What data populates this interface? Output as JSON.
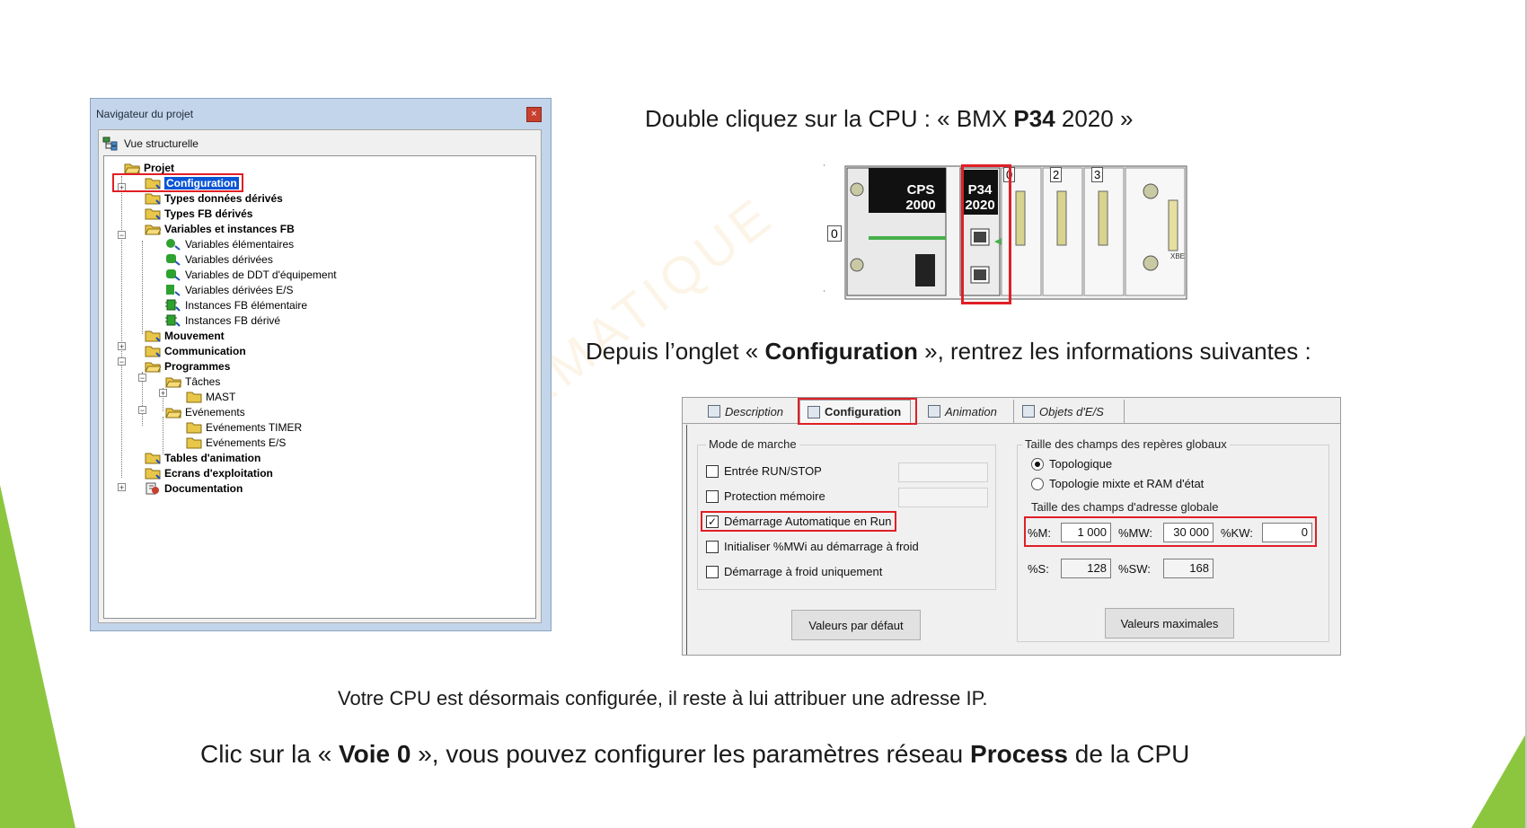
{
  "nav": {
    "title": "Navigateur du projet",
    "close_glyph": "×",
    "view_label": "Vue structurelle",
    "items": [
      {
        "label": "Projet",
        "icon": "folder-open-icon"
      },
      {
        "label": "Configuration",
        "icon": "folder-icon",
        "selected": true
      },
      {
        "label": "Types données dérivés",
        "icon": "folder-icon"
      },
      {
        "label": "Types FB dérivés",
        "icon": "folder-icon"
      },
      {
        "label": "Variables et instances FB",
        "icon": "folder-open-icon"
      },
      {
        "label": "Variables élémentaires",
        "icon": "variable-icon"
      },
      {
        "label": "Variables dérivées",
        "icon": "variable-icon"
      },
      {
        "label": "Variables de DDT d'équipement",
        "icon": "variable-icon"
      },
      {
        "label": "Variables dérivées E/S",
        "icon": "variable-icon"
      },
      {
        "label": "Instances FB élémentaire",
        "icon": "fb-instance-icon"
      },
      {
        "label": "Instances FB dérivé",
        "icon": "fb-instance-icon"
      },
      {
        "label": "Mouvement",
        "icon": "folder-icon"
      },
      {
        "label": "Communication",
        "icon": "folder-icon"
      },
      {
        "label": "Programmes",
        "icon": "folder-open-icon"
      },
      {
        "label": "Tâches",
        "icon": "folder-open-icon"
      },
      {
        "label": "MAST",
        "icon": "folder-icon"
      },
      {
        "label": "Evénements",
        "icon": "folder-open-icon"
      },
      {
        "label": "Evénements TIMER",
        "icon": "folder-icon"
      },
      {
        "label": "Evénements E/S",
        "icon": "folder-icon"
      },
      {
        "label": "Tables d'animation",
        "icon": "folder-icon"
      },
      {
        "label": "Ecrans d'exploitation",
        "icon": "folder-icon"
      },
      {
        "label": "Documentation",
        "icon": "documentation-icon"
      }
    ],
    "expander_plus": "+",
    "expander_minus": "−"
  },
  "captions": {
    "step1_prefix": "Double cliquez sur la CPU : « BMX ",
    "step1_bold": "P34",
    "step1_suffix": " 2020 »",
    "step2_prefix": "Depuis l’onglet « ",
    "step2_bold": "Configuration",
    "step2_suffix": " », rentrez les informations suivantes :",
    "step3": "Votre CPU est désormais configurée, il reste à lui attribuer une adresse IP.",
    "step4_prefix": "Clic sur la « ",
    "step4_bold1": "Voie 0",
    "step4_mid": " », vous pouvez configurer les paramètres réseau ",
    "step4_bold2": "Process",
    "step4_suffix": " de la CPU"
  },
  "rack": {
    "cps_line1": "CPS",
    "cps_line2": "2000",
    "cpu_line1": "P34",
    "cpu_line2": "2020",
    "slot_labels": [
      "0",
      "2",
      "3"
    ],
    "left_label": "0",
    "xbe_label": "XBE"
  },
  "config": {
    "tabs": [
      "Description",
      "Configuration",
      "Animation",
      "Objets d'E/S"
    ],
    "active_tab": "Configuration",
    "mode_group_label": "Mode de marche",
    "checkboxes": [
      {
        "label": "Entrée RUN/STOP",
        "checked": false
      },
      {
        "label": "Protection mémoire",
        "checked": false
      },
      {
        "label": "Démarrage Automatique en Run",
        "checked": true
      },
      {
        "label": "Initialiser %MWi au démarrage à froid",
        "checked": false
      },
      {
        "label": "Démarrage à froid uniquement",
        "checked": false
      }
    ],
    "check_glyph": "✓",
    "default_button": "Valeurs par défaut",
    "size_group_label": "Taille des champs des repères globaux",
    "radios": [
      {
        "label": "Topologique",
        "selected": true
      },
      {
        "label": "Topologie mixte et RAM d'état",
        "selected": false
      }
    ],
    "address_size_label": "Taille des champs d'adresse globale",
    "fields": {
      "m_label": "%M:",
      "m_value": "1 000",
      "mw_label": "%MW:",
      "mw_value": "30 000",
      "kw_label": "%KW:",
      "kw_value": "0",
      "s_label": "%S:",
      "s_value": "128",
      "sw_label": "%SW:",
      "sw_value": "168"
    },
    "max_button": "Valeurs maximales"
  },
  "colors": {
    "accent_green": "#8cc63f",
    "highlight_red": "#e01f26",
    "selection_blue": "#0a55d5"
  }
}
